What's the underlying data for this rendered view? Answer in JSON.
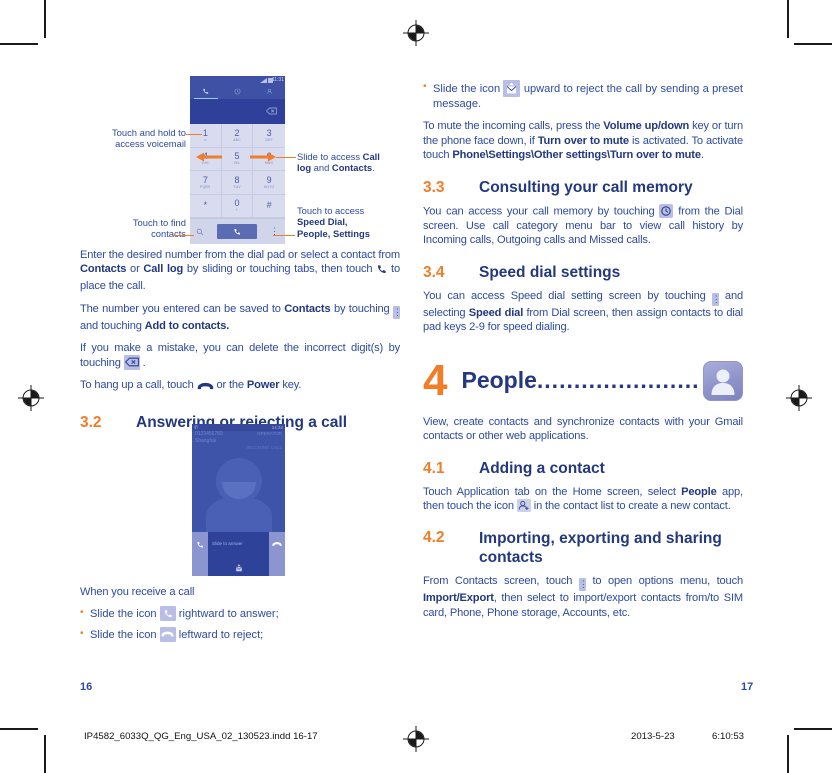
{
  "document": {
    "left_page_number": "16",
    "right_page_number": "17",
    "imprint_filename": "IP4582_6033Q_QG_Eng_USA_02_130523.indd   16-17",
    "imprint_date": "2013-5-23",
    "imprint_time": "6:10:53"
  },
  "colors": {
    "heading_blue": "#23387f",
    "body_blue": "#2e4a9e",
    "accent_orange": "#f07d28",
    "chip_lavender": "#b9bfe4",
    "phone_dark_blue": "#3f51a5",
    "phone_light": "#d9dcee"
  },
  "left_column": {
    "callouts": [
      {
        "id": "voicemail",
        "line1": "Touch and hold to",
        "line2": "access voicemail"
      },
      {
        "id": "find-contacts",
        "line1": "Touch to find",
        "line2": "contacts"
      },
      {
        "id": "slide-tabs",
        "text_before": "Slide to access ",
        "bold1": "Call log",
        "text_mid": " and ",
        "bold2": "Contacts",
        "text_after": "."
      },
      {
        "id": "overflow-menu",
        "line1": "Touch to access",
        "line2_bold": "Speed Dial,",
        "line3_bold": "People, Settings"
      }
    ],
    "paragraphs": [
      {
        "id": "enter-number",
        "runs": [
          {
            "t": "Enter the desired number from the dial pad or select a contact from ",
            "b": false
          },
          {
            "t": "Contacts",
            "b": true
          },
          {
            "t": " or ",
            "b": false
          },
          {
            "t": "Call log",
            "b": true
          },
          {
            "t": " by sliding or touching tabs, then touch ",
            "b": false
          },
          {
            "t": "[phone-icon]",
            "b": false,
            "icon": "phone-receiver"
          },
          {
            "t": " to place the call.",
            "b": false
          }
        ]
      },
      {
        "id": "save-number",
        "runs": [
          {
            "t": "The number you entered can be saved to ",
            "b": false
          },
          {
            "t": "Contacts",
            "b": true
          },
          {
            "t": " by touching ",
            "b": false
          },
          {
            "t": "[menu-icon]",
            "b": false,
            "icon": "overflow-dots"
          },
          {
            "t": " and touching ",
            "b": false
          },
          {
            "t": "Add to contacts.",
            "b": true
          }
        ]
      },
      {
        "id": "delete-digit",
        "runs": [
          {
            "t": "If you make a mistake, you can delete the incorrect digit(s) by touching ",
            "b": false
          },
          {
            "t": "[backspace-icon]",
            "b": false,
            "icon": "backspace"
          },
          {
            "t": " .",
            "b": false
          }
        ]
      },
      {
        "id": "hang-up",
        "runs": [
          {
            "t": "To hang up a call, touch ",
            "b": false
          },
          {
            "t": "[end-call-icon]",
            "b": false,
            "icon": "end-call"
          },
          {
            "t": "  or the ",
            "b": false
          },
          {
            "t": "Power",
            "b": true
          },
          {
            "t": " key.",
            "b": false
          }
        ]
      }
    ],
    "section_3_2": {
      "number": "3.2",
      "title": "Answering or rejecting a call"
    },
    "receive_call_label": "When you receive a call",
    "receive_bullets": [
      {
        "before": "Slide the icon ",
        "icon": "answer-call",
        "after": " rightward to answer;"
      },
      {
        "before": "Slide the icon ",
        "icon": "reject-call",
        "after": " leftward to reject;"
      }
    ],
    "dialer_mock": {
      "status_time": "11:31",
      "tabs": [
        "dialpad-icon",
        "clock-icon",
        "contacts-icon"
      ],
      "keys": [
        {
          "digit": "1",
          "sub": "∞"
        },
        {
          "digit": "2",
          "sub": "ABC"
        },
        {
          "digit": "3",
          "sub": "DEF"
        },
        {
          "digit": "4",
          "sub": "GHI"
        },
        {
          "digit": "5",
          "sub": "JKL"
        },
        {
          "digit": "6",
          "sub": "MNO"
        },
        {
          "digit": "7",
          "sub": "PQRS"
        },
        {
          "digit": "8",
          "sub": "TUV"
        },
        {
          "digit": "9",
          "sub": "WXYZ"
        },
        {
          "digit": "*",
          "sub": ""
        },
        {
          "digit": "0",
          "sub": "+"
        },
        {
          "digit": "#",
          "sub": ""
        }
      ],
      "bottom_bar": {
        "search": "search-icon",
        "call": "call-button",
        "menu": "overflow-menu"
      }
    },
    "incoming_call_mock": {
      "number": "0123456789",
      "operator": "OPERATOR",
      "location": "Shanghai",
      "state_label": "INCOMING CALL",
      "slide_label": "Slide to answer",
      "slide_sub": "",
      "status_time": "14:32"
    }
  },
  "right_column": {
    "top_bullet": {
      "before": "Slide the icon ",
      "icon": "message-reject",
      "after": " upward to reject the call by sending a preset message."
    },
    "mute_paragraph": {
      "runs": [
        {
          "t": "To mute the incoming calls, press the ",
          "b": false
        },
        {
          "t": "Volume up/down",
          "b": true
        },
        {
          "t": " key or turn the phone face down, if ",
          "b": false
        },
        {
          "t": "Turn over to mute",
          "b": true
        },
        {
          "t": " is activated. To activate touch ",
          "b": false
        },
        {
          "t": "Phone\\Settings\\Other settings\\Turn over to mute",
          "b": true
        },
        {
          "t": ".",
          "b": false
        }
      ]
    },
    "section_3_3": {
      "number": "3.3",
      "title": "Consulting your call memory",
      "runs": [
        {
          "t": "You can access your call memory by touching ",
          "b": false
        },
        {
          "t": "[clock-icon]",
          "b": false,
          "icon": "call-log-clock"
        },
        {
          "t": " from the Dial screen. Use call category menu bar to view call history by Incoming calls, Outgoing calls and Missed calls.",
          "b": false
        }
      ]
    },
    "section_3_4": {
      "number": "3.4",
      "title": "Speed dial settings",
      "runs": [
        {
          "t": "You can access Speed dial setting screen by touching ",
          "b": false
        },
        {
          "t": "[menu-icon]",
          "b": false,
          "icon": "overflow-dots"
        },
        {
          "t": " and selecting ",
          "b": false
        },
        {
          "t": "Speed dial",
          "b": true
        },
        {
          "t": " from Dial screen, then assign contacts to dial pad keys 2-9 for speed dialing.",
          "b": false
        }
      ]
    },
    "chapter_4": {
      "number": "4",
      "title": "People",
      "dots": "......................",
      "icon": "people-contact-icon"
    },
    "chapter_4_intro": "View, create contacts and synchronize contacts with your Gmail contacts or other web applications.",
    "section_4_1": {
      "number": "4.1",
      "title": "Adding a contact",
      "runs": [
        {
          "t": "Touch Application tab on the Home screen, select ",
          "b": false
        },
        {
          "t": "People",
          "b": true
        },
        {
          "t": " app, then touch the icon ",
          "b": false
        },
        {
          "t": "[add-contact-icon]",
          "b": false,
          "icon": "add-contact"
        },
        {
          "t": " in the contact list to create a new contact.",
          "b": false
        }
      ]
    },
    "section_4_2": {
      "number": "4.2",
      "title_line1": "Importing, exporting and sharing",
      "title_line2": "contacts",
      "runs": [
        {
          "t": "From Contacts screen, touch ",
          "b": false
        },
        {
          "t": "[menu-icon]",
          "b": false,
          "icon": "overflow-dots"
        },
        {
          "t": " to open options menu, touch ",
          "b": false
        },
        {
          "t": "Import/Export",
          "b": true
        },
        {
          "t": ", then select to import/export contacts from/to SIM card, Phone, Phone storage, Accounts, etc.",
          "b": false
        }
      ]
    }
  }
}
